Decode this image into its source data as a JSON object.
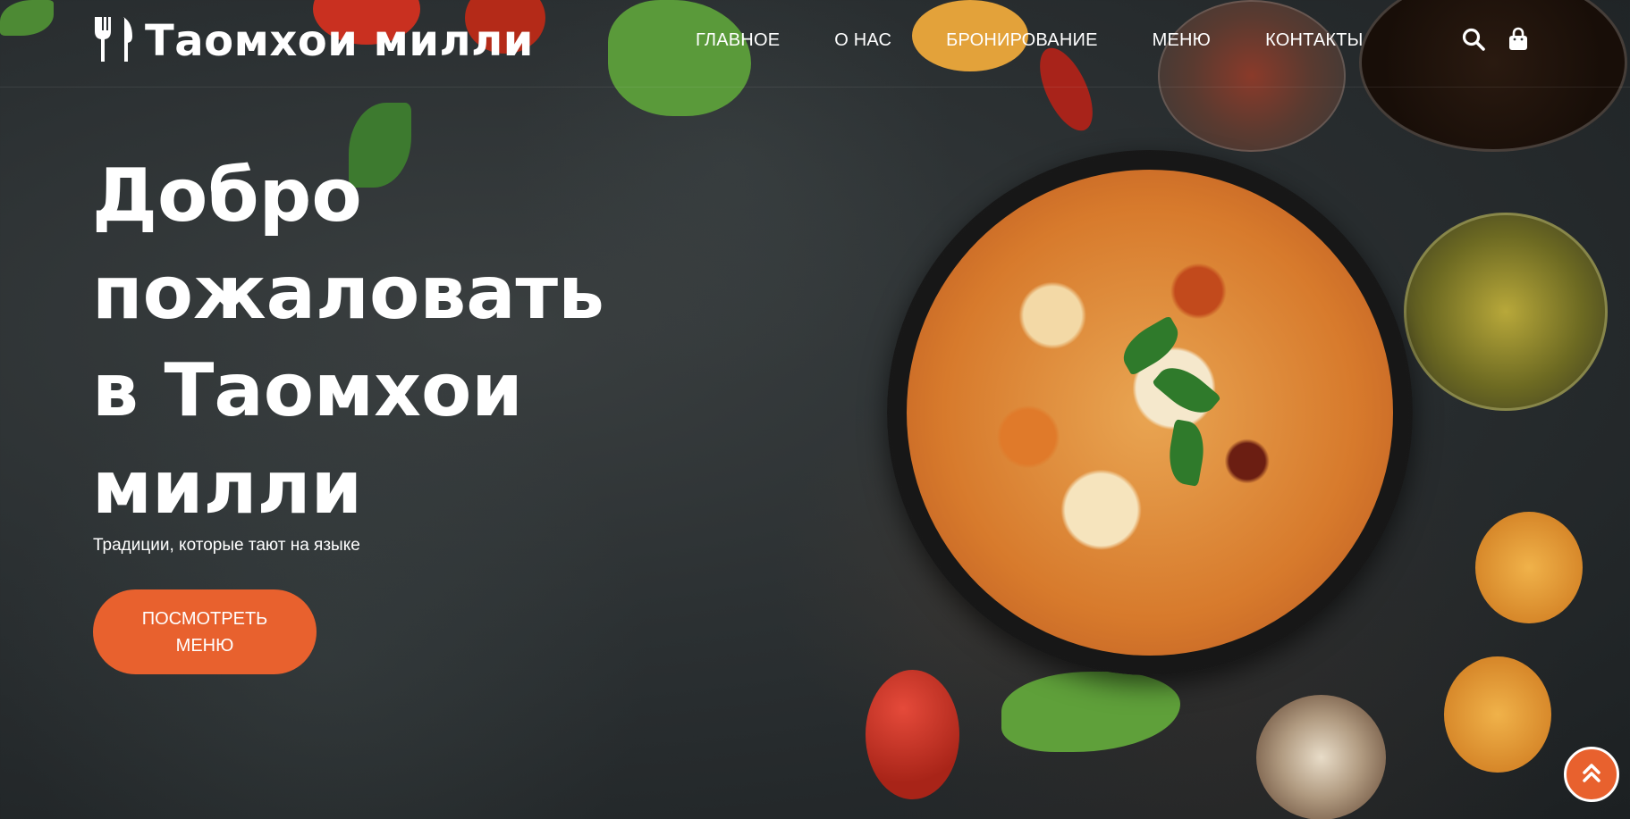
{
  "brand": {
    "name": "Таомхои милли",
    "logo_icon": "fork-knife-icon"
  },
  "nav": {
    "items": [
      {
        "label": "ГЛАВНОЕ"
      },
      {
        "label": "О НАС"
      },
      {
        "label": "БРОНИРОВАНИЕ"
      },
      {
        "label": "МЕНЮ"
      },
      {
        "label": "КОНТАКТЫ"
      }
    ]
  },
  "header_icons": {
    "search": "search-icon",
    "bag": "shopping-bag-icon"
  },
  "hero": {
    "title_lines": [
      "Добро",
      "пожаловать",
      "в Таомхои",
      "милли"
    ],
    "subtitle": "Традиции, которые тают на языке",
    "cta_label": "ПОСМОТРЕТЬ МЕНЮ"
  },
  "scroll_top": {
    "icon": "double-chevron-up-icon"
  },
  "colors": {
    "accent": "#e8612e",
    "background": "#2b3032",
    "text": "#ffffff"
  }
}
